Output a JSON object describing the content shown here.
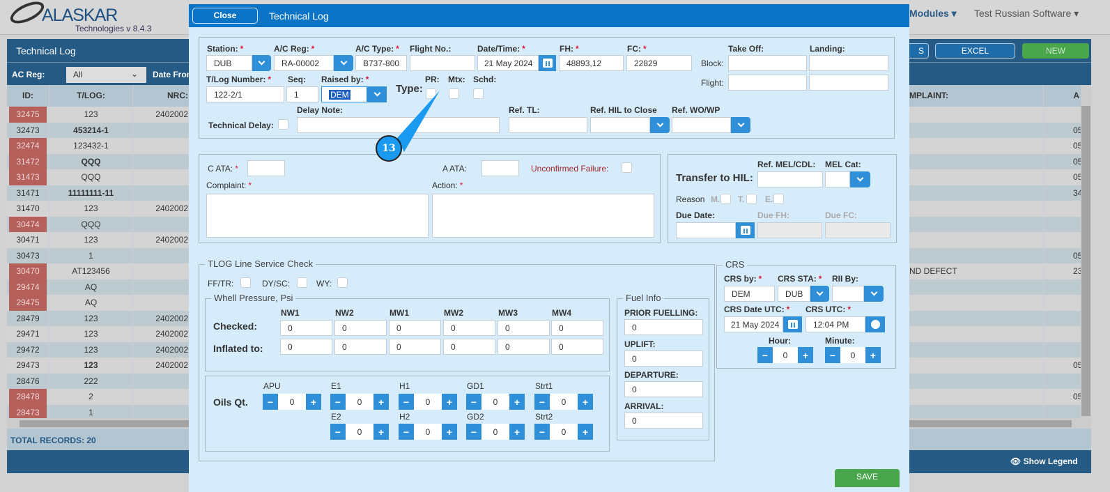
{
  "app": {
    "logo": "ALASKAR",
    "logo_sub": "Technologies",
    "version": "v 8.4.3",
    "nav": [
      "Modules",
      "Test Russian Software"
    ]
  },
  "panel": {
    "title": "Technical Log",
    "buttons": [
      "S",
      "EXCEL",
      "NEW"
    ],
    "filter_label": "AC Reg:",
    "filter_value": "All",
    "date_from_label": "Date From",
    "total": "TOTAL RECORDS: 20",
    "show_legend": "Show Legend"
  },
  "columns": [
    "ID:",
    "T/LOG:",
    "NRC:",
    "MPLAINT:",
    "A"
  ],
  "rows": [
    {
      "id": "32475",
      "tlog": "123",
      "nrc": "2402002",
      "red": true,
      "bold": false,
      "complaint": "",
      "a": ""
    },
    {
      "id": "32473",
      "tlog": "453214-1",
      "nrc": "",
      "red": false,
      "bold": true,
      "complaint": "",
      "a": "05"
    },
    {
      "id": "32474",
      "tlog": "123432-1",
      "nrc": "",
      "red": true,
      "bold": false,
      "complaint": "",
      "a": "05"
    },
    {
      "id": "31472",
      "tlog": "QQQ",
      "nrc": "",
      "red": true,
      "bold": true,
      "complaint": "",
      "a": "05"
    },
    {
      "id": "31473",
      "tlog": "QQQ",
      "nrc": "",
      "red": true,
      "bold": false,
      "complaint": "",
      "a": "05"
    },
    {
      "id": "31471",
      "tlog": "11111111-11",
      "nrc": "",
      "red": false,
      "bold": true,
      "complaint": "",
      "a": "34"
    },
    {
      "id": "31470",
      "tlog": "123",
      "nrc": "2402002",
      "red": false,
      "bold": false,
      "complaint": "",
      "a": ""
    },
    {
      "id": "30474",
      "tlog": "QQQ",
      "nrc": "",
      "red": true,
      "bold": false,
      "complaint": "",
      "a": ""
    },
    {
      "id": "30471",
      "tlog": "123",
      "nrc": "2402002",
      "red": false,
      "bold": false,
      "complaint": "",
      "a": ""
    },
    {
      "id": "30473",
      "tlog": "1",
      "nrc": "",
      "red": false,
      "bold": false,
      "complaint": "",
      "a": "05"
    },
    {
      "id": "30470",
      "tlog": "AT123456",
      "nrc": "",
      "red": true,
      "bold": false,
      "complaint": "ND DEFECT",
      "a": "23"
    },
    {
      "id": "29474",
      "tlog": "AQ",
      "nrc": "",
      "red": true,
      "bold": false,
      "complaint": "",
      "a": ""
    },
    {
      "id": "29475",
      "tlog": "AQ",
      "nrc": "",
      "red": true,
      "bold": false,
      "complaint": "",
      "a": ""
    },
    {
      "id": "28479",
      "tlog": "123",
      "nrc": "2402002",
      "red": false,
      "bold": false,
      "complaint": "",
      "a": ""
    },
    {
      "id": "29471",
      "tlog": "123",
      "nrc": "2402002",
      "red": false,
      "bold": false,
      "complaint": "",
      "a": ""
    },
    {
      "id": "29472",
      "tlog": "123",
      "nrc": "2402002",
      "red": false,
      "bold": false,
      "complaint": "",
      "a": ""
    },
    {
      "id": "29473",
      "tlog": "123",
      "nrc": "2402002",
      "red": false,
      "bold": true,
      "complaint": "",
      "a": "05"
    },
    {
      "id": "28476",
      "tlog": "222",
      "nrc": "",
      "red": false,
      "bold": false,
      "complaint": "",
      "a": ""
    },
    {
      "id": "28478",
      "tlog": "2",
      "nrc": "",
      "red": true,
      "bold": false,
      "complaint": "",
      "a": "05"
    },
    {
      "id": "28473",
      "tlog": "1",
      "nrc": "",
      "red": true,
      "bold": false,
      "complaint": "",
      "a": ""
    }
  ],
  "modal": {
    "close": "Close",
    "title": "Technical Log",
    "save": "SAVE",
    "station": {
      "label": "Station:",
      "value": "DUB"
    },
    "ac_reg": {
      "label": "A/C Reg:",
      "value": "RA-00002"
    },
    "ac_type": {
      "label": "A/C Type:",
      "value": "B737-800"
    },
    "flight_no": {
      "label": "Flight No.:",
      "value": ""
    },
    "datetime": {
      "label": "Date/Time:",
      "value": "21 May 2024"
    },
    "fh": {
      "label": "FH:",
      "value": "48893,12"
    },
    "fc": {
      "label": "FC:",
      "value": "22829"
    },
    "take_off": "Take Off:",
    "landing": "Landing:",
    "block": "Block:",
    "flight": "Flight:",
    "tlog_number": {
      "label": "T/Log Number:",
      "value": "122-2/1"
    },
    "seq": {
      "label": "Seq:",
      "value": "1"
    },
    "raised_by": {
      "label": "Raised by:",
      "value": "DEM"
    },
    "type_label": "Type:",
    "pr": "PR:",
    "mtx": "Mtx:",
    "schd": "Schd:",
    "technical_delay": "Technical Delay:",
    "delay_note": "Delay Note:",
    "ref_tl": "Ref. TL:",
    "ref_hil": "Ref. HIL to Close",
    "ref_wo": "Ref. WO/WP",
    "callout": "13",
    "c_ata": "C ATA:",
    "a_ata": "A ATA:",
    "unconfirmed": "Unconfirmed Failure:",
    "complaint": "Complaint:",
    "action": "Action:",
    "transfer_hil": "Transfer to HIL:",
    "ref_mel": "Ref. MEL/CDL:",
    "mel_cat": "MEL Cat:",
    "reason": "Reason",
    "reason_m": "M.",
    "reason_t": "T.",
    "reason_e": "E.",
    "due_date": "Due Date:",
    "due_fh": "Due FH:",
    "due_fc": "Due FC:",
    "line_check": {
      "legend": "TLOG Line Service Check",
      "fftr": "FF/TR:",
      "dysc": "DY/SC:",
      "wy": "WY:"
    },
    "wheel": {
      "legend": "Whell Pressure, Psi",
      "cols": [
        "NW1",
        "NW2",
        "MW1",
        "MW2",
        "MW3",
        "MW4"
      ],
      "checked_label": "Checked:",
      "inflated_label": "Inflated to:",
      "checked": [
        "0",
        "0",
        "0",
        "0",
        "0",
        "0"
      ],
      "inflated": [
        "0",
        "0",
        "0",
        "0",
        "0",
        "0"
      ]
    },
    "oils": {
      "label": "Oils Qt.",
      "row1": [
        {
          "name": "APU",
          "value": "0"
        },
        {
          "name": "E1",
          "value": "0"
        },
        {
          "name": "H1",
          "value": "0"
        },
        {
          "name": "GD1",
          "value": "0"
        },
        {
          "name": "Strt1",
          "value": "0"
        }
      ],
      "row2": [
        {
          "name": "E2",
          "value": "0"
        },
        {
          "name": "H2",
          "value": "0"
        },
        {
          "name": "GD2",
          "value": "0"
        },
        {
          "name": "Strt2",
          "value": "0"
        }
      ]
    },
    "fuel": {
      "legend": "Fuel Info",
      "items": [
        {
          "label": "PRIOR FUELLING:",
          "value": "0"
        },
        {
          "label": "UPLIFT:",
          "value": "0"
        },
        {
          "label": "DEPARTURE:",
          "value": "0"
        },
        {
          "label": "ARRIVAL:",
          "value": "0"
        }
      ]
    },
    "crs": {
      "legend": "CRS",
      "by_label": "CRS by:",
      "by": "DEM",
      "sta_label": "CRS STA:",
      "sta": "DUB",
      "rii_label": "RII By:",
      "date_label": "CRS Date UTC:",
      "date": "21 May 2024",
      "utc_label": "CRS UTC:",
      "utc": "12:04 PM",
      "hour_label": "Hour:",
      "hour": "0",
      "minute_label": "Minute:",
      "minute": "0"
    }
  }
}
